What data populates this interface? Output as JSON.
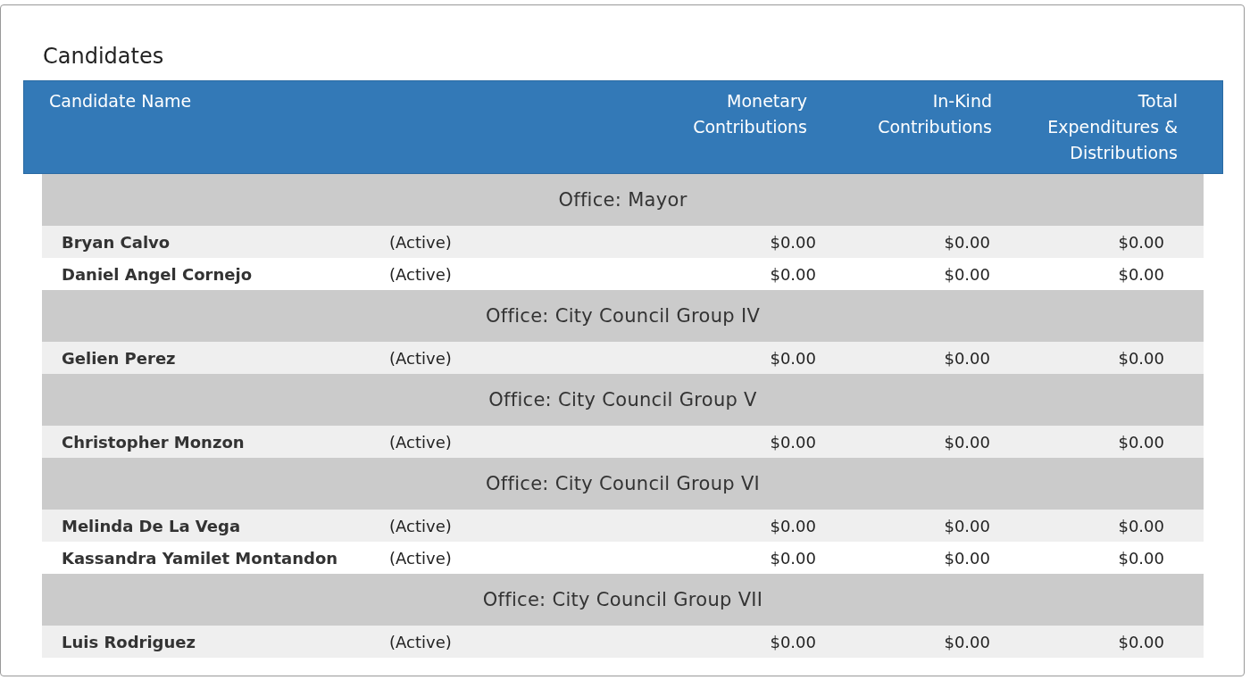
{
  "title": "Candidates",
  "columns": [
    {
      "label": "Candidate Name"
    },
    {
      "label": "Monetary\nContributions"
    },
    {
      "label": "In-Kind\nContributions"
    },
    {
      "label": "Total\nExpenditures &\nDistributions"
    }
  ],
  "groups": [
    {
      "office": "Office: Mayor",
      "candidates": [
        {
          "name": "Bryan Calvo",
          "status": "(Active)",
          "monetary": "$0.00",
          "in_kind": "$0.00",
          "total": "$0.00"
        },
        {
          "name": "Daniel Angel Cornejo",
          "status": "(Active)",
          "monetary": "$0.00",
          "in_kind": "$0.00",
          "total": "$0.00"
        }
      ]
    },
    {
      "office": "Office: City Council Group IV",
      "candidates": [
        {
          "name": "Gelien Perez",
          "status": "(Active)",
          "monetary": "$0.00",
          "in_kind": "$0.00",
          "total": "$0.00"
        }
      ]
    },
    {
      "office": "Office: City Council Group V",
      "candidates": [
        {
          "name": "Christopher Monzon",
          "status": "(Active)",
          "monetary": "$0.00",
          "in_kind": "$0.00",
          "total": "$0.00"
        }
      ]
    },
    {
      "office": "Office: City Council Group VI",
      "candidates": [
        {
          "name": "Melinda De La Vega",
          "status": "(Active)",
          "monetary": "$0.00",
          "in_kind": "$0.00",
          "total": "$0.00"
        },
        {
          "name": "Kassandra Yamilet Montandon",
          "status": "(Active)",
          "monetary": "$0.00",
          "in_kind": "$0.00",
          "total": "$0.00"
        }
      ]
    },
    {
      "office": "Office: City Council Group VII",
      "candidates": [
        {
          "name": "Luis Rodriguez",
          "status": "(Active)",
          "monetary": "$0.00",
          "in_kind": "$0.00",
          "total": "$0.00"
        }
      ]
    }
  ]
}
